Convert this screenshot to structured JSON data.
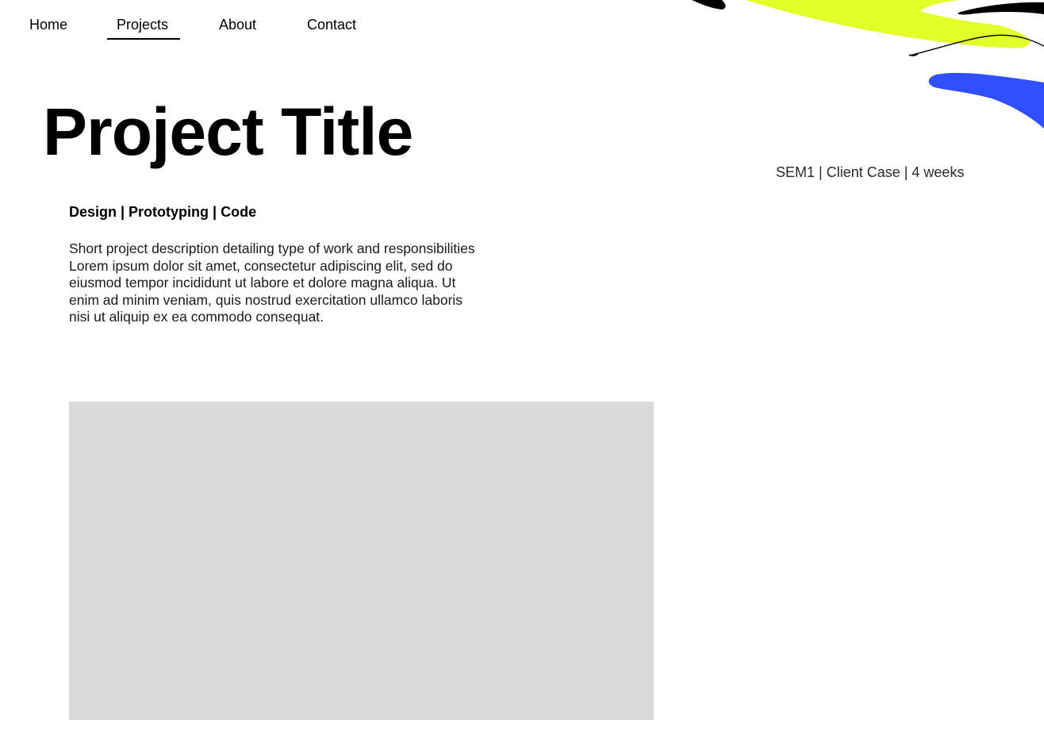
{
  "nav": {
    "items": [
      {
        "label": "Home"
      },
      {
        "label": "Projects"
      },
      {
        "label": "About"
      },
      {
        "label": "Contact"
      }
    ],
    "active": "Projects"
  },
  "project": {
    "title": "Project Title",
    "meta": "SEM1 | Client Case | 4 weeks",
    "tags": "Design | Prototyping | Code",
    "description_lines": [
      "Short project description detailing type of work and responsibilities",
      "Lorem ipsum dolor sit amet, consectetur adipiscing elit, sed do",
      "eiusmod tempor incididunt ut labore et dolore magna aliqua. Ut",
      "enim ad minim veniam, quis nostrud exercitation ullamco laboris",
      "nisi ut aliquip ex ea commodo consequat."
    ]
  },
  "colors": {
    "accent_yellow": "#e3ff2a",
    "accent_blue": "#2f4fff",
    "accent_black": "#000000",
    "placeholder_gray": "#d9d9d9"
  }
}
